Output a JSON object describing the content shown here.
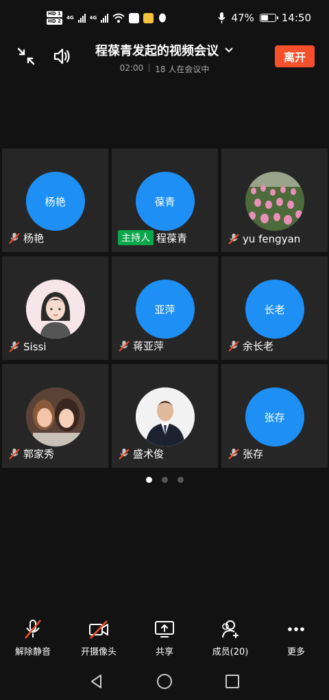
{
  "status_bar": {
    "hd1": "HD 1",
    "hd2": "HD 2",
    "net1": "4G",
    "net2": "4G",
    "battery": "47%",
    "time": "14:50"
  },
  "header": {
    "title": "程葆青发起的视频会议",
    "duration": "02:00",
    "participants": "18 人在会议中",
    "leave_label": "离开"
  },
  "participants": [
    {
      "name": "杨艳",
      "avatar_text": "杨艳",
      "avatar_type": "text",
      "muted": true
    },
    {
      "name": "程葆青",
      "avatar_text": "葆青",
      "avatar_type": "text",
      "muted": false,
      "badge": "主持人"
    },
    {
      "name": "yu fengyan",
      "avatar_text": "",
      "avatar_type": "tulips-photo",
      "muted": true
    },
    {
      "name": "Sissi",
      "avatar_text": "",
      "avatar_type": "cartoon-girl",
      "muted": true
    },
    {
      "name": "蒋亚萍",
      "avatar_text": "亚萍",
      "avatar_type": "text",
      "muted": true
    },
    {
      "name": "余长老",
      "avatar_text": "长老",
      "avatar_type": "text",
      "muted": true
    },
    {
      "name": "郭家秀",
      "avatar_text": "",
      "avatar_type": "selfie-photo",
      "muted": true
    },
    {
      "name": "盛术俊",
      "avatar_text": "",
      "avatar_type": "suit-photo",
      "muted": true
    },
    {
      "name": "张存",
      "avatar_text": "张存",
      "avatar_type": "text",
      "muted": true
    }
  ],
  "pagination": {
    "pages": 3,
    "current": 1
  },
  "toolbar": {
    "unmute": "解除静音",
    "camera": "开摄像头",
    "share": "共享",
    "members": "成员(20)",
    "more": "更多"
  },
  "colors": {
    "accent": "#1e90f5",
    "leave": "#f5502b",
    "host_badge": "#0aa64a",
    "mute_red": "#f5502b"
  }
}
